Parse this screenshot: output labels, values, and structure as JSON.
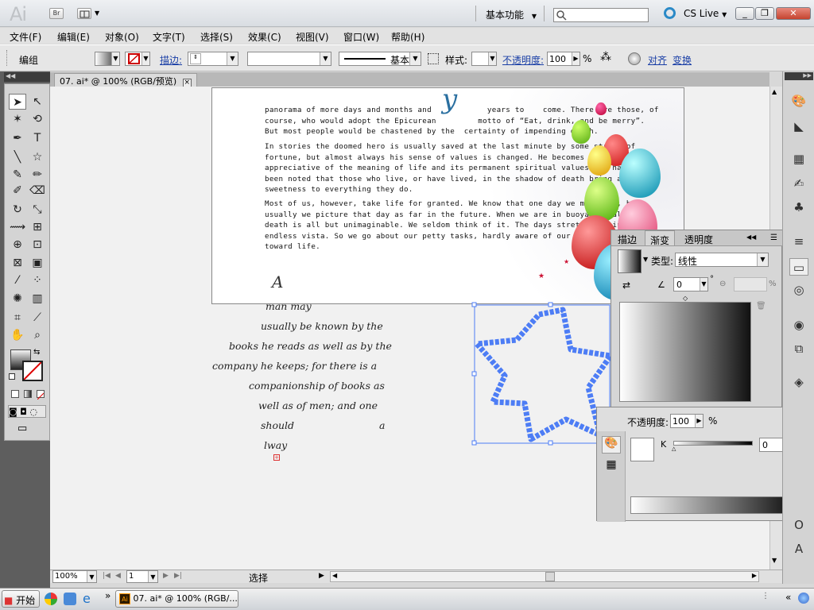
{
  "app": {
    "logo": "Ai",
    "bridge_label": "Br",
    "workspace": "基本功能",
    "cs_live": "CS Live",
    "win_controls": {
      "minimize": "_",
      "restore": "❐",
      "close": "✕"
    }
  },
  "menu": [
    "文件(F)",
    "编辑(E)",
    "对象(O)",
    "文字(T)",
    "选择(S)",
    "效果(C)",
    "视图(V)",
    "窗口(W)",
    "帮助(H)"
  ],
  "control_bar": {
    "selection_label": "编组",
    "stroke_label": "描边:",
    "stroke_style": "基本",
    "style_label": "样式:",
    "opacity_label": "不透明度:",
    "opacity_value": "100",
    "percent": "%",
    "align_label": "对齐",
    "transform_label": "变换"
  },
  "document_tab": {
    "title": "07. ai* @ 100% (RGB/预览)",
    "close": "×"
  },
  "document": {
    "para1": [
      "panorama of more days and months and            years to    come. There are those, of",
      "course, who would adopt the Epicurean         motto of “Eat, drink, and be merry”.",
      "But most people would be chastened by the  certainty of impending death."
    ],
    "para2": [
      "In stories the doomed hero is usually saved at the last minute by some stroke of",
      "fortune, but almost always his sense of values is changed. He becomes more",
      "appreciative of the meaning of life and its permanent spiritual values. It has often",
      "been noted that those who live, or have lived, in the shadow of death bring a mellow",
      "sweetness to everything they do."
    ],
    "para3": [
      "Most of us, however, take life for granted. We know that one day we must die, but",
      "usually we picture that day as far in the future. When we are in buoyant health,",
      "death is all but unimaginable. We seldom think of it. The days stretch out in an",
      "endless vista. So we go about our petty tasks, hardly aware of our listless attitude",
      "toward life."
    ],
    "drop_cap": "A",
    "script_lines": [
      "man may",
      "usually be known by the",
      "books he reads as well as by the",
      "company he keeps; for there is a",
      "companionship of books as",
      "well as of men; and one",
      "should",
      "a",
      "lway"
    ]
  },
  "gradient_panel": {
    "tabs": [
      "描边",
      "渐变",
      "透明度"
    ],
    "type_label": "类型:",
    "type_value": "线性",
    "angle_value": "0",
    "degree": "°",
    "percent": "%"
  },
  "color_panel": {
    "opacity_label": "不透明度:",
    "opacity_value": "100",
    "percent": "%",
    "channel_label": "K",
    "channel_value": "0"
  },
  "status": {
    "zoom": "100%",
    "artboard": "1",
    "tool": "选择"
  },
  "taskbar": {
    "start": "开始",
    "task": "07. ai* @ 100% (RGB/...",
    "chevron_more": "»",
    "tray_chevron": "«"
  },
  "colors": {
    "selection_blue": "#4d7df5",
    "canvas_bg": "#f1f1f1",
    "link_blue": "#1a3fa6"
  }
}
